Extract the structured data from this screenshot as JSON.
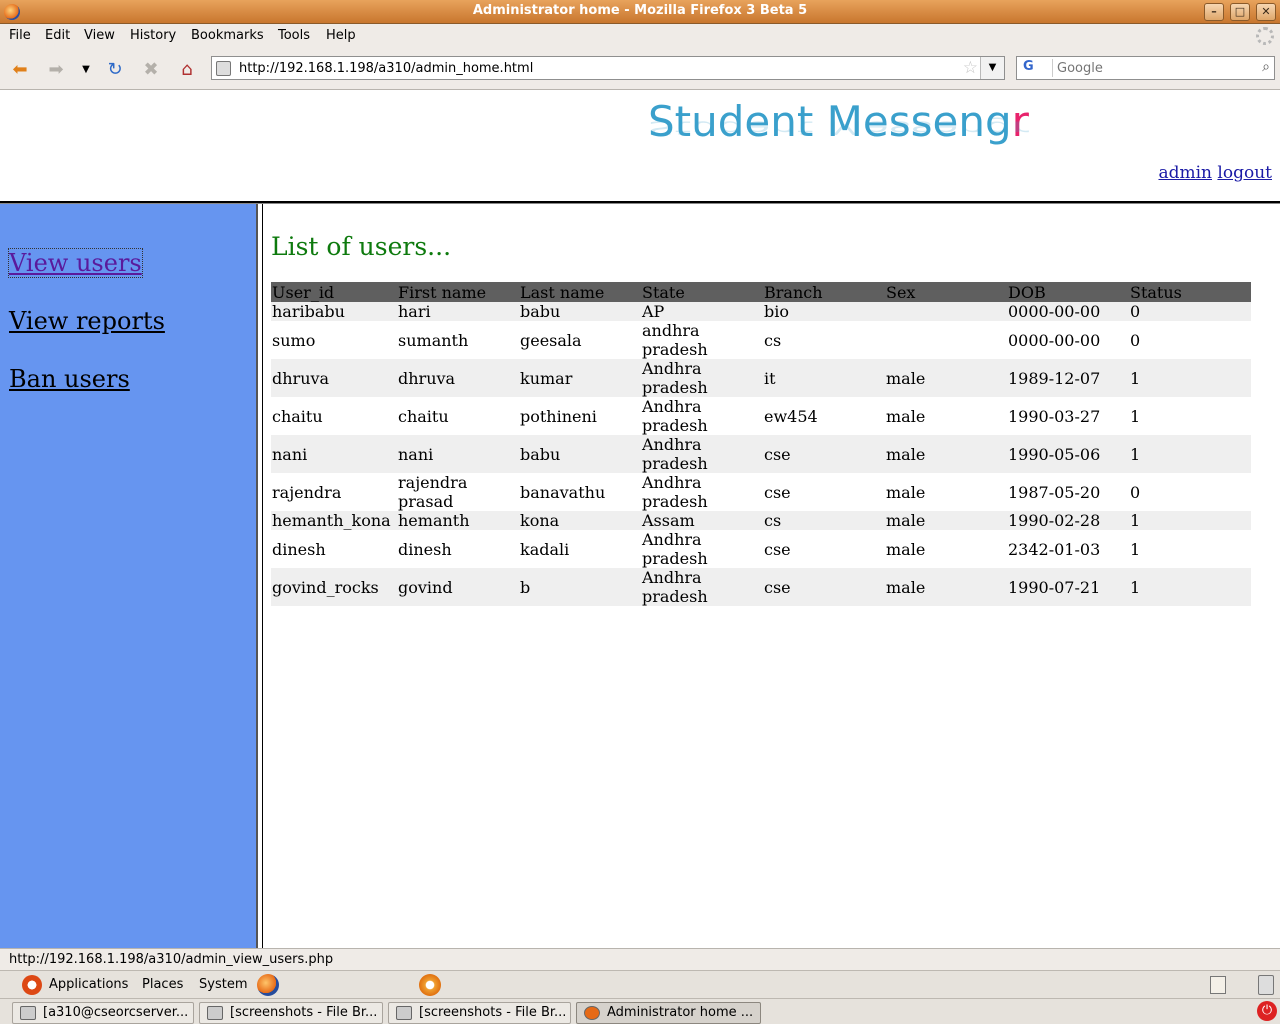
{
  "window": {
    "title": "Administrator home - Mozilla Firefox 3 Beta 5"
  },
  "menu": {
    "items": [
      "File",
      "Edit",
      "View",
      "History",
      "Bookmarks",
      "Tools",
      "Help"
    ]
  },
  "nav": {
    "url": "http://192.168.1.198/a310/admin_home.html",
    "search_placeholder": "Google",
    "search_engine": "G"
  },
  "page": {
    "logo_main": "Student Messeng",
    "logo_accent": "r",
    "top_links": {
      "admin": "admin",
      "logout": "logout"
    },
    "sidebar": [
      "View users",
      "View reports",
      "Ban users"
    ],
    "heading": "List of users...",
    "table": {
      "headers": [
        "User_id",
        "First name",
        "Last name",
        "State",
        "Branch",
        "Sex",
        "DOB",
        "Status"
      ],
      "rows": [
        [
          "haribabu",
          "hari",
          "babu",
          "AP",
          "bio",
          "",
          "0000-00-00",
          "0"
        ],
        [
          "sumo",
          "sumanth",
          "geesala",
          "andhra pradesh",
          "cs",
          "",
          "0000-00-00",
          "0"
        ],
        [
          "dhruva",
          "dhruva",
          "kumar",
          "Andhra pradesh",
          "it",
          "male",
          "1989-12-07",
          "1"
        ],
        [
          "chaitu",
          "chaitu",
          "pothineni",
          "Andhra pradesh",
          "ew454",
          "male",
          "1990-03-27",
          "1"
        ],
        [
          "nani",
          "nani",
          "babu",
          "Andhra pradesh",
          "cse",
          "male",
          "1990-05-06",
          "1"
        ],
        [
          "rajendra",
          "rajendra prasad",
          "banavathu",
          "Andhra pradesh",
          "cse",
          "male",
          "1987-05-20",
          "0"
        ],
        [
          "hemanth_kona",
          "hemanth",
          "kona",
          "Assam",
          "cs",
          "male",
          "1990-02-28",
          "1"
        ],
        [
          "dinesh",
          "dinesh",
          "kadali",
          "Andhra pradesh",
          "cse",
          "male",
          "2342-01-03",
          "1"
        ],
        [
          "govind_rocks",
          "govind",
          "b",
          "Andhra pradesh",
          "cse",
          "male",
          "1990-07-21",
          "1"
        ]
      ]
    }
  },
  "status": {
    "text": "http://192.168.1.198/a310/admin_view_users.php"
  },
  "panel": {
    "menus": [
      "Applications",
      "Places",
      "System"
    ],
    "tasks": [
      "[a310@cseorcserver...",
      "[screenshots - File Br...",
      "[screenshots - File Br...",
      "Administrator home ..."
    ]
  },
  "colors": {
    "sidebar": "#6695f0",
    "heading": "#0e7a0e",
    "table_header": "#5f5f5f",
    "row_alt": "#efefef"
  }
}
